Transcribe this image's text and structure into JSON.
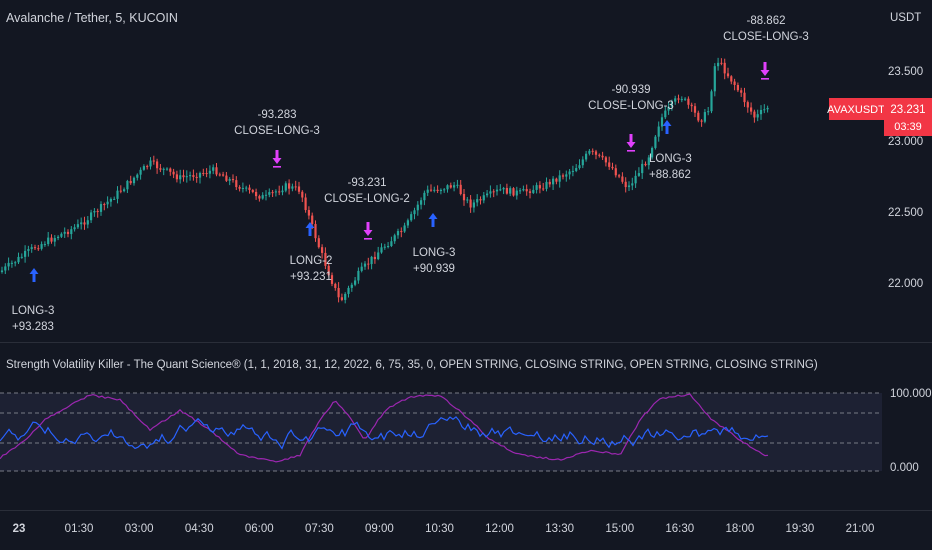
{
  "chart": {
    "symbol_title": "Avalanche / Tether, 5, KUCOIN",
    "currency": "USDT",
    "price_badge": {
      "label": "AVAXUSDT",
      "price": "23.231",
      "countdown": "03:39"
    },
    "colors": {
      "up": "#26a69a",
      "down": "#ef5350",
      "long_arrow": "#2962ff",
      "close_arrow": "#e040fb",
      "badge": "#f23645",
      "background": "#131722"
    }
  },
  "price_axis": {
    "ticks": [
      "23.500",
      "23.000",
      "22.500",
      "22.000"
    ]
  },
  "indicator": {
    "title": "Strength Volatility Killer - The Quant Science® (1, 1, 2018, 31, 12, 2022, 6, 75, 35, 0, OPEN STRING, CLOSING STRING, OPEN STRING, CLOSING STRING)",
    "ticks": [
      "100.000",
      "0.000"
    ],
    "upper_level": 100,
    "lower_level": 0,
    "line_colors": {
      "strength": "#2962ff",
      "volatility": "#9c27b0"
    }
  },
  "time_axis": {
    "labels": [
      "23",
      "01:30",
      "03:00",
      "04:30",
      "06:00",
      "07:30",
      "09:00",
      "10:30",
      "12:00",
      "13:30",
      "15:00",
      "16:30",
      "18:00",
      "19:30",
      "21:00"
    ]
  },
  "signals": [
    {
      "type": "long",
      "name": "LONG-3",
      "value": "+93.283"
    },
    {
      "type": "close",
      "name": "CLOSE-LONG-3",
      "value": "-93.283"
    },
    {
      "type": "long",
      "name": "LONG-2",
      "value": "+93.231"
    },
    {
      "type": "close",
      "name": "CLOSE-LONG-2",
      "value": "-93.231"
    },
    {
      "type": "long",
      "name": "LONG-3",
      "value": "+90.939"
    },
    {
      "type": "close",
      "name": "CLOSE-LONG-3",
      "value": "-90.939"
    },
    {
      "type": "long",
      "name": "LONG-3",
      "value": "+88.862"
    },
    {
      "type": "close",
      "name": "CLOSE-LONG-3",
      "value": "-88.862"
    }
  ]
}
